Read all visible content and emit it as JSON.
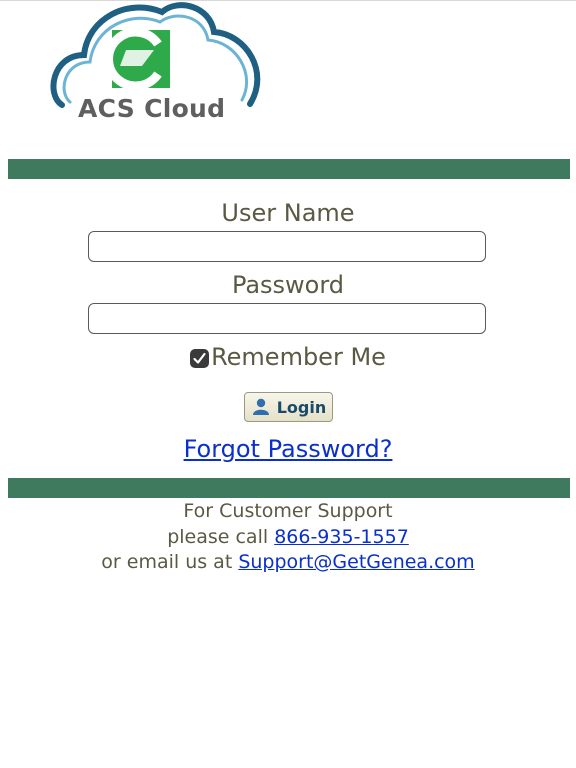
{
  "logo": {
    "text": "ACS Cloud",
    "icon": "acs-cloud-logo",
    "colors": {
      "cloud_outline": "#1e5f82",
      "cloud_inner": "#6bb4d6",
      "mark_green": "#2eaa4a"
    }
  },
  "form": {
    "username_label": "User Name",
    "username_value": "",
    "password_label": "Password",
    "password_value": "",
    "remember_label": "Remember Me",
    "remember_checked": true,
    "login_label": "Login",
    "login_icon": "user-icon",
    "forgot_label": "Forgot Password?"
  },
  "support": {
    "line1": "For Customer Support",
    "line2_prefix": "please call ",
    "phone": "866-935-1557",
    "line3_prefix": "or email us at ",
    "email": "Support@GetGenea.com"
  },
  "colors": {
    "band": "#3f7a5e",
    "text": "#5a5a44",
    "link": "#0a2fcc"
  }
}
